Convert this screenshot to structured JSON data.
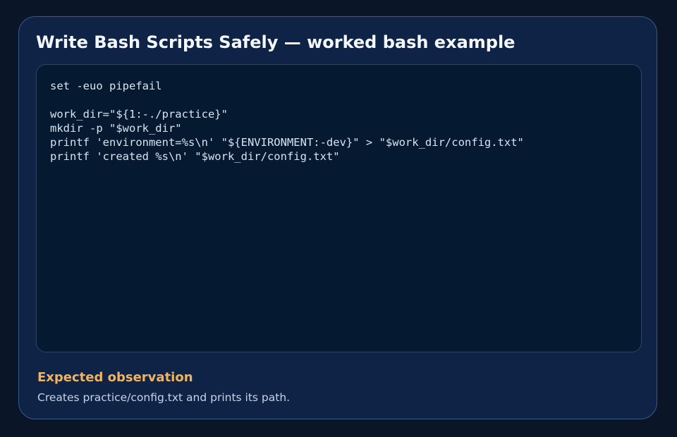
{
  "card": {
    "title": "Write Bash Scripts Safely — worked bash example",
    "code": {
      "language": "bash",
      "lines": [
        "set -euo pipefail",
        "",
        "work_dir=\"${1:-./practice}\"",
        "mkdir -p \"$work_dir\"",
        "printf 'environment=%s\\n' \"${ENVIRONMENT:-dev}\" > \"$work_dir/config.txt\"",
        "printf 'created %s\\n' \"$work_dir/config.txt\""
      ]
    },
    "observation": {
      "heading": "Expected observation",
      "text": "Creates practice/config.txt and prints its path."
    }
  },
  "colors": {
    "page_background": "#0a1628",
    "card_background": "#0e2346",
    "code_background": "#051a31",
    "title": "#f4f7fb",
    "code_text": "#d8e3f0",
    "observation_heading": "#f2b35c",
    "observation_text": "#c6d3e6"
  }
}
